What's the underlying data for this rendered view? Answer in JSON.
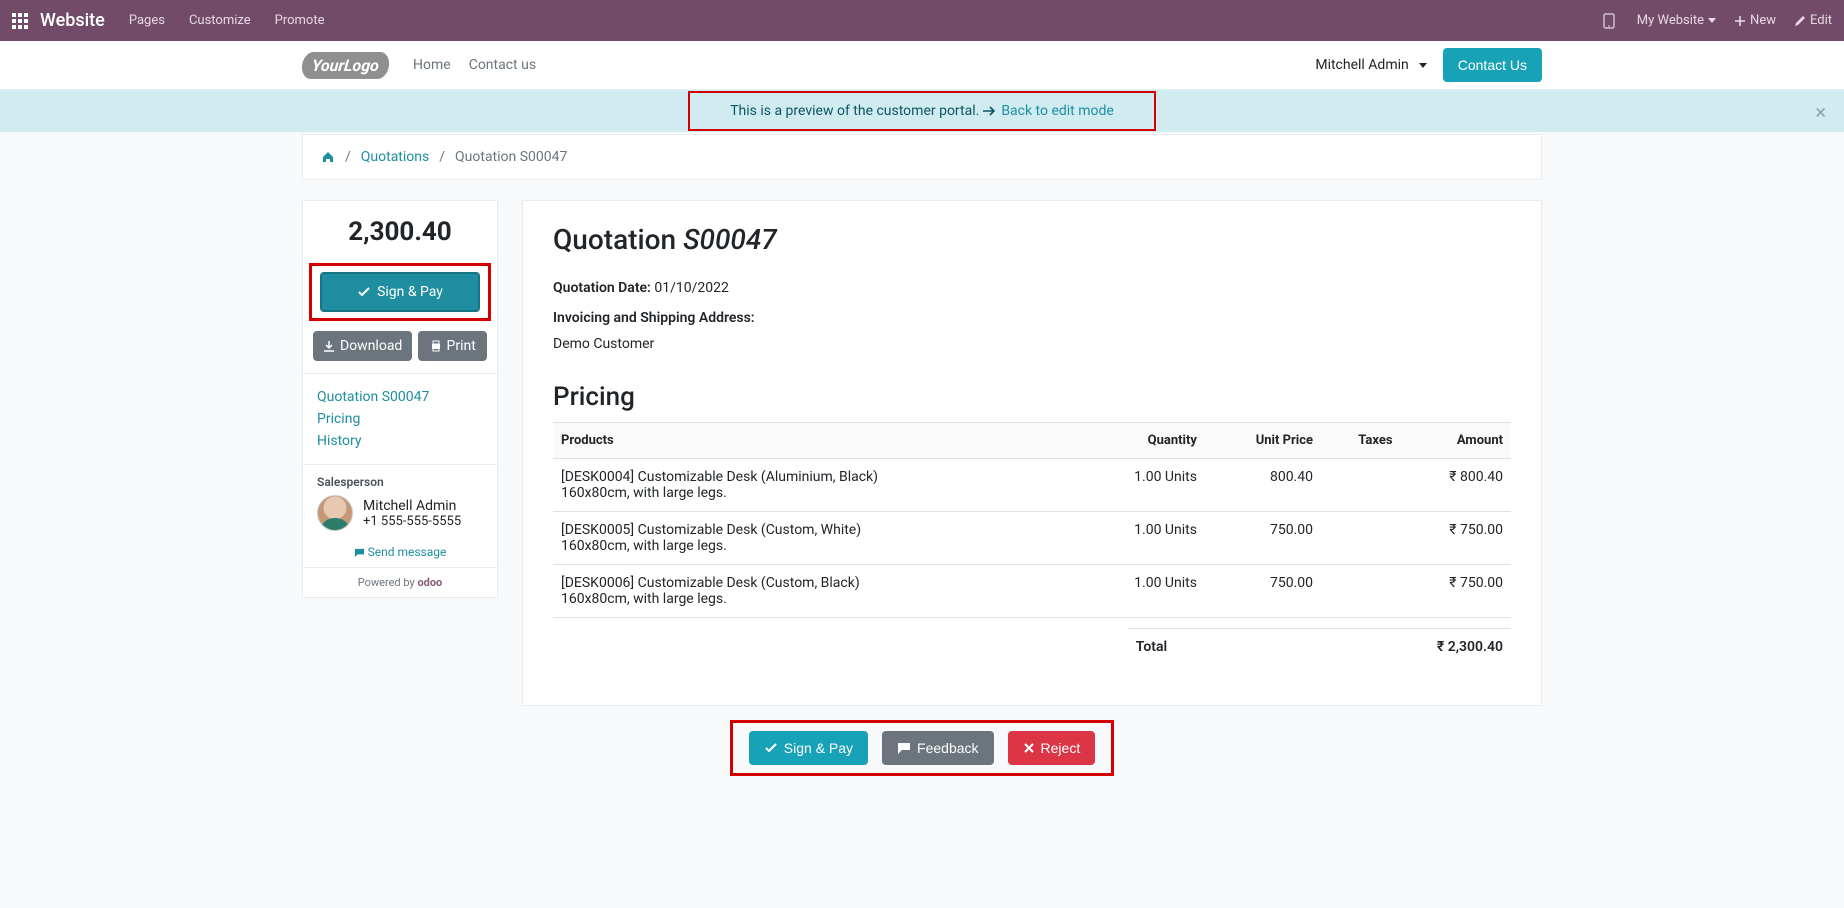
{
  "topbar": {
    "brand": "Website",
    "menu": [
      "Pages",
      "Customize",
      "Promote"
    ],
    "my_website": "My Website",
    "new": "New",
    "edit": "Edit"
  },
  "navbar": {
    "logo_text": "YourLogo",
    "links": [
      "Home",
      "Contact us"
    ],
    "user": "Mitchell Admin",
    "contact_us": "Contact Us"
  },
  "alert": {
    "text": "This is a preview of the customer portal. ",
    "link": "Back to edit mode"
  },
  "breadcrumb": {
    "quotations": "Quotations",
    "current": "Quotation S00047"
  },
  "sidebar": {
    "total": "2,300.40",
    "sign_pay": "Sign & Pay",
    "download": "Download",
    "print": "Print",
    "links": [
      "Quotation S00047",
      "Pricing",
      "History"
    ],
    "salesperson_label": "Salesperson",
    "salesperson_name": "Mitchell Admin",
    "salesperson_phone": "+1 555-555-5555",
    "send_message": "Send message",
    "powered_by": "Powered by",
    "powered_brand": "odoo"
  },
  "content": {
    "title_prefix": "Quotation ",
    "title_number": "S00047",
    "quotation_date_label": "Quotation Date:",
    "quotation_date": "01/10/2022",
    "address_label": "Invoicing and Shipping Address:",
    "address_value": "Demo Customer",
    "pricing_title": "Pricing",
    "columns": {
      "products": "Products",
      "quantity": "Quantity",
      "unit_price": "Unit Price",
      "taxes": "Taxes",
      "amount": "Amount"
    },
    "lines": [
      {
        "name1": "[DESK0004] Customizable Desk (Aluminium, Black)",
        "name2": "160x80cm, with large legs.",
        "qty": "1.00 Units",
        "unit": "800.40",
        "tax": "",
        "amount": "₹ 800.40"
      },
      {
        "name1": "[DESK0005] Customizable Desk (Custom, White)",
        "name2": "160x80cm, with large legs.",
        "qty": "1.00 Units",
        "unit": "750.00",
        "tax": "",
        "amount": "₹ 750.00"
      },
      {
        "name1": "[DESK0006] Customizable Desk (Custom, Black)",
        "name2": "160x80cm, with large legs.",
        "qty": "1.00 Units",
        "unit": "750.00",
        "tax": "",
        "amount": "₹ 750.00"
      }
    ],
    "total_label": "Total",
    "total_value": "₹ 2,300.40"
  },
  "actions": {
    "sign_pay": "Sign & Pay",
    "feedback": "Feedback",
    "reject": "Reject"
  }
}
